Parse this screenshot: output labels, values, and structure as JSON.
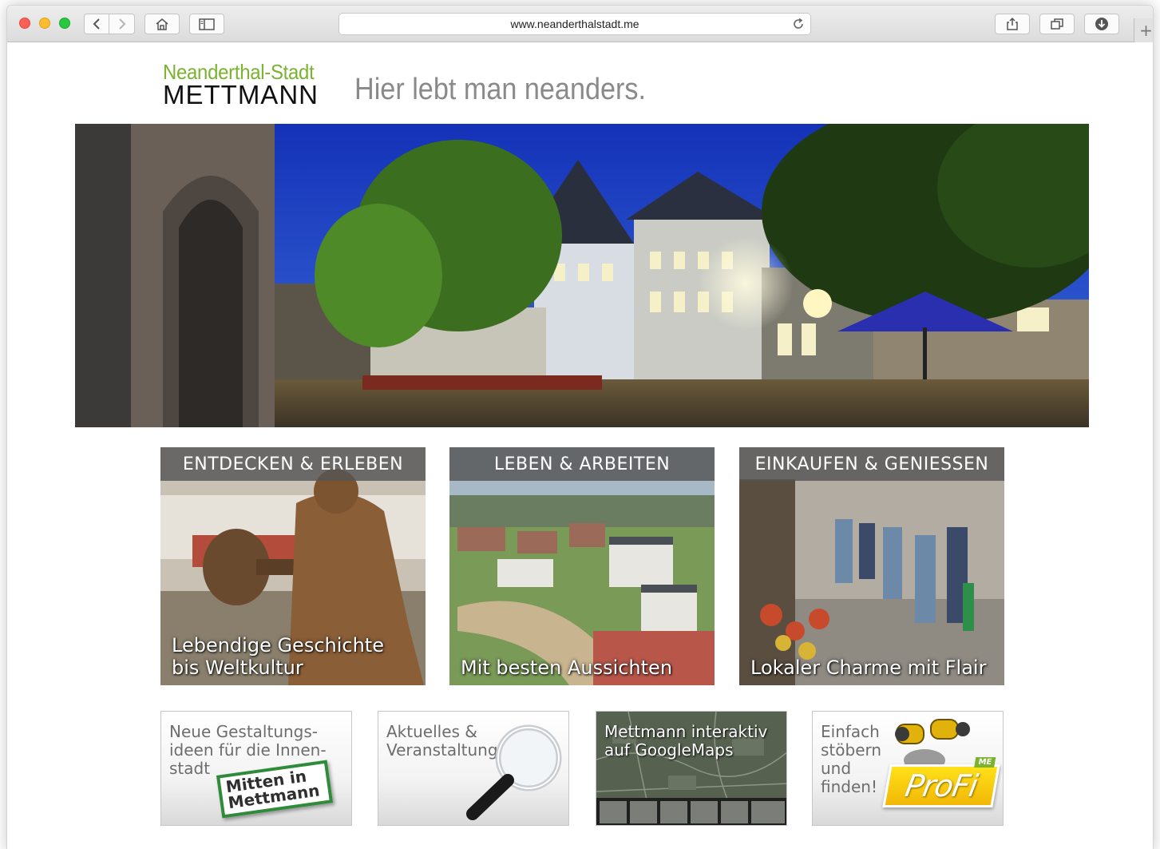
{
  "browser": {
    "url": "www.neanderthalstadt.me",
    "new_tab_label": "+",
    "buttons": {
      "back_icon": "chevron-left-icon",
      "forward_icon": "chevron-right-icon",
      "home_icon": "home-icon",
      "sidebar_icon": "sidebar-icon",
      "reload_icon": "reload-icon",
      "share_icon": "share-icon",
      "tabs_icon": "tabs-overview-icon",
      "download_icon": "download-icon"
    }
  },
  "header": {
    "logo_top": "Neanderthal-Stadt",
    "logo_bottom": "METTMANN",
    "tagline": "Hier lebt man neanders."
  },
  "hero": {
    "image": "Mettmann old town square at dusk with historic houses, trees, café tables and a blue parasol"
  },
  "cards": [
    {
      "title": "ENTDECKEN & ERLEBEN",
      "caption": "Lebendige Geschichte\nbis Weltkultur"
    },
    {
      "title": "LEBEN & ARBEITEN",
      "caption": "Mit besten Aussichten"
    },
    {
      "title": "EINKAUFEN & GENIESSEN",
      "caption": "Lokaler Charme mit Flair"
    }
  ],
  "tiles": [
    {
      "text": "Neue Gestaltungs-\nideen für die Innen-\nstadt",
      "badge": "Mitten in\nMettmann"
    },
    {
      "text": "Aktuelles &\nVeranstaltungs-Tipps"
    },
    {
      "text": "Mettmann interaktiv\nauf GoogleMaps"
    },
    {
      "text": "Einfach\nstöbern\nund\nfinden!",
      "logo": "ProFi",
      "logo_tag": "ME"
    }
  ],
  "colors": {
    "logo_green": "#7ab32e",
    "tagline_gray": "#8a8a8a",
    "card_band": "#555555"
  }
}
